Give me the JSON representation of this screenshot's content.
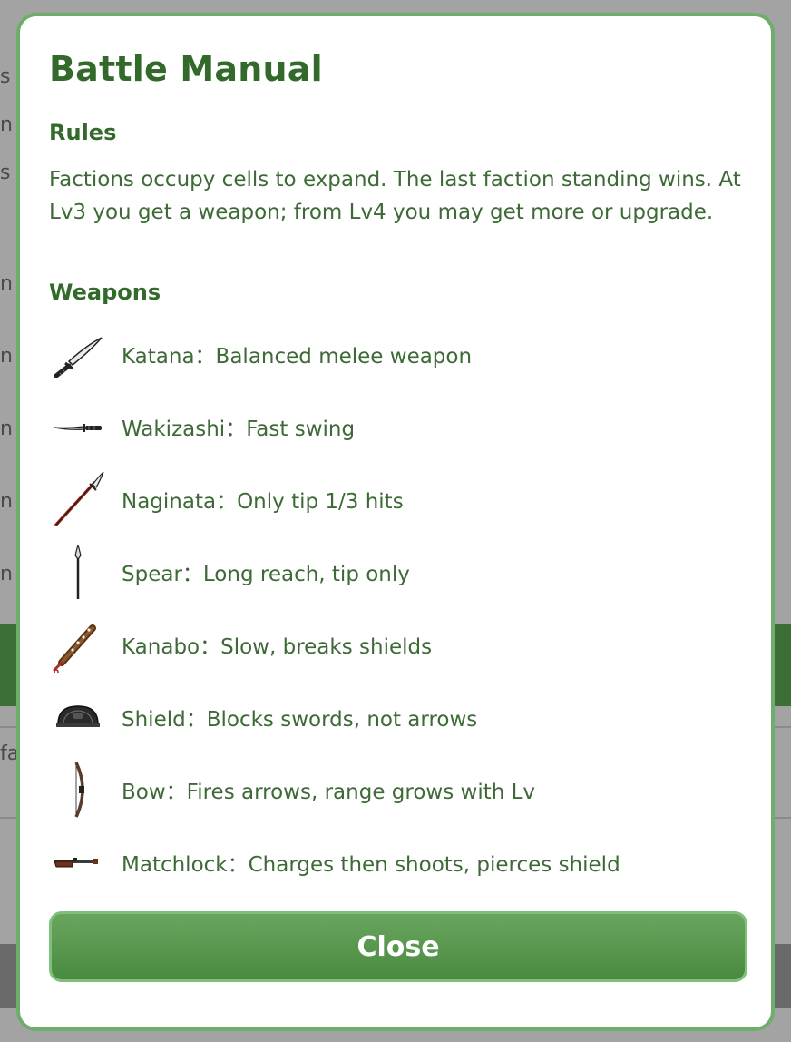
{
  "modal": {
    "title": "Battle Manual",
    "rules_heading": "Rules",
    "rules_text": "Factions occupy cells to expand. The last faction standing wins. At Lv3 you get a weapon; from Lv4 you may get more or upgrade.",
    "weapons_heading": "Weapons",
    "weapons": [
      {
        "icon": "katana-icon",
        "text": "Katana：Balanced melee weapon"
      },
      {
        "icon": "wakizashi-icon",
        "text": "Wakizashi：Fast swing"
      },
      {
        "icon": "naginata-icon",
        "text": "Naginata：Only tip 1/3 hits"
      },
      {
        "icon": "spear-icon",
        "text": "Spear：Long reach, tip only"
      },
      {
        "icon": "kanabo-icon",
        "text": "Kanabo：Slow, breaks shields"
      },
      {
        "icon": "shield-icon",
        "text": "Shield：Blocks swords, not arrows"
      },
      {
        "icon": "bow-icon",
        "text": "Bow：Fires arrows, range grows with Lv"
      },
      {
        "icon": "matchlock-icon",
        "text": "Matchlock：Charges then shoots, pierces shield"
      }
    ],
    "close_label": "Close"
  },
  "background": {
    "fragments": [
      "s",
      "n",
      "s",
      "n",
      "n",
      "n",
      "n",
      "n",
      "fa"
    ]
  },
  "colors": {
    "accent": "#336a2c",
    "body_text": "#3d6a36",
    "border": "#6fae6a",
    "button": "#4e8c44"
  }
}
